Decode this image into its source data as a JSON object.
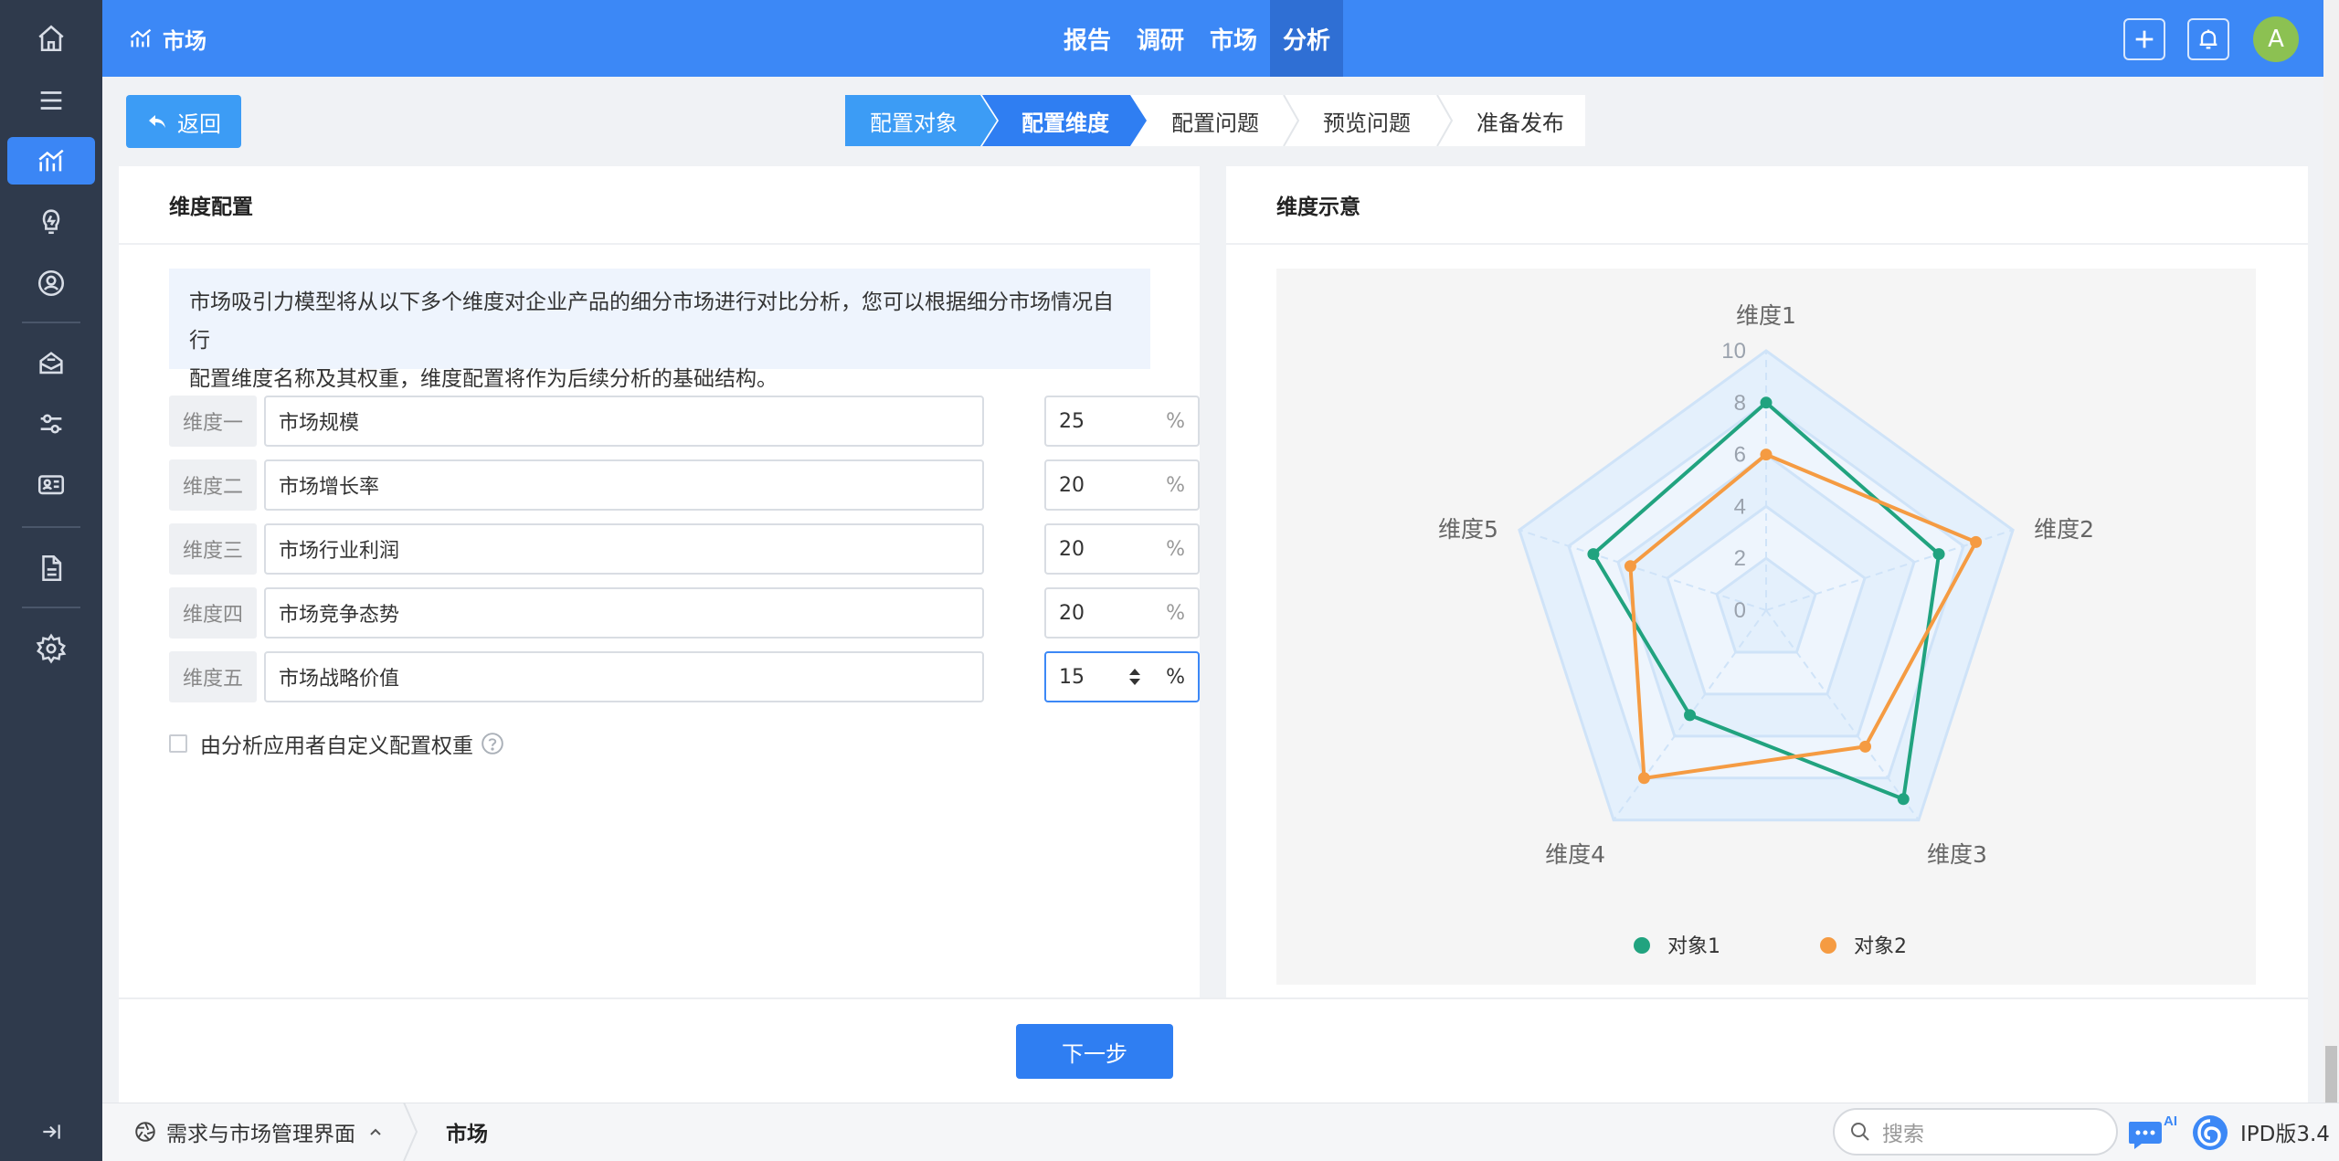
{
  "header": {
    "brand": "市场",
    "nav": [
      "报告",
      "调研",
      "市场",
      "分析"
    ],
    "active_nav": "分析",
    "avatar_letter": "A"
  },
  "back_label": "返回",
  "steps": [
    "配置对象",
    "配置维度",
    "配置问题",
    "预览问题",
    "准备发布"
  ],
  "left_panel": {
    "title": "维度配置",
    "description_line1": "市场吸引力模型将从以下多个维度对企业产品的细分市场进行对比分析，您可以根据细分市场情况自行",
    "description_line2": "配置维度名称及其权重，维度配置将作为后续分析的基础结构。",
    "dimensions": [
      {
        "label": "维度一",
        "name": "市场规模",
        "weight": "25"
      },
      {
        "label": "维度二",
        "name": "市场增长率",
        "weight": "20"
      },
      {
        "label": "维度三",
        "name": "市场行业利润",
        "weight": "20"
      },
      {
        "label": "维度四",
        "name": "市场竞争态势",
        "weight": "20"
      },
      {
        "label": "维度五",
        "name": "市场战略价值",
        "weight": "15"
      }
    ],
    "unit": "%",
    "custom_weight_label": "由分析应用者自定义配置权重"
  },
  "right_panel": {
    "title": "维度示意"
  },
  "chart_data": {
    "type": "radar",
    "axes": [
      "维度1",
      "维度2",
      "维度3",
      "维度4",
      "维度5"
    ],
    "range": [
      0,
      10
    ],
    "ticks": [
      "0",
      "2",
      "4",
      "6",
      "8",
      "10"
    ],
    "series": [
      {
        "name": "对象1",
        "color": "#21a37f",
        "values": [
          8,
          7,
          9,
          5,
          7
        ]
      },
      {
        "name": "对象2",
        "color": "#f59b42",
        "values": [
          6,
          8.5,
          6.5,
          8,
          5.5
        ]
      }
    ],
    "legend_position": "bottom"
  },
  "next_label": "下一步",
  "statusbar": {
    "home_crumb": "需求与市场管理界面",
    "current_crumb": "市场",
    "search_placeholder": "搜索",
    "ai_badge": "AI",
    "version": "IPD版3.4"
  },
  "colors": {
    "primary": "#3c88f6",
    "sidebar": "#2f3a4c",
    "step_done": "#3c9cf5",
    "step_active": "#2f7ef2"
  }
}
